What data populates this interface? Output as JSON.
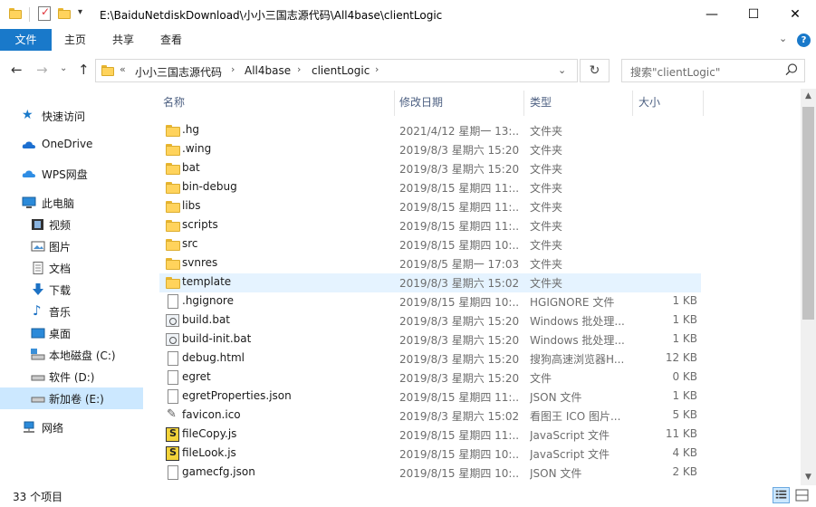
{
  "window": {
    "title": "E:\\BaiduNetdiskDownload\\小小三国志源代码\\All4base\\clientLogic",
    "minimize": "—",
    "maximize": "☐",
    "close": "✕"
  },
  "ribbon": {
    "tabs": [
      "文件",
      "主页",
      "共享",
      "查看"
    ],
    "expand": "⌄",
    "help": "?"
  },
  "nav": {
    "back": "←",
    "forward": "→",
    "recent": "⌄",
    "up": "↑",
    "overflow": "«",
    "breadcrumbs": [
      "小小三国志源代码",
      "All4base",
      "clientLogic"
    ],
    "crumb_sep": "›",
    "dropdown": "⌄",
    "refresh": "↻",
    "search_placeholder": "搜索\"clientLogic\""
  },
  "sidebar": {
    "items": [
      {
        "label": "快速访问",
        "icon": "star-icon"
      },
      {
        "label": "OneDrive",
        "icon": "cloud-icon"
      },
      {
        "label": "WPS网盘",
        "icon": "wps-cloud-icon"
      },
      {
        "label": "此电脑",
        "icon": "computer-icon"
      },
      {
        "label": "视频",
        "icon": "video-icon"
      },
      {
        "label": "图片",
        "icon": "pictures-icon"
      },
      {
        "label": "文档",
        "icon": "documents-icon"
      },
      {
        "label": "下载",
        "icon": "download-icon"
      },
      {
        "label": "音乐",
        "icon": "music-icon"
      },
      {
        "label": "桌面",
        "icon": "desktop-icon"
      },
      {
        "label": "本地磁盘 (C:)",
        "icon": "drive-c-icon"
      },
      {
        "label": "软件 (D:)",
        "icon": "drive-icon"
      },
      {
        "label": "新加卷 (E:)",
        "icon": "drive-icon",
        "selected": true
      },
      {
        "label": "网络",
        "icon": "network-icon"
      }
    ]
  },
  "list": {
    "sort_indicator": "^",
    "headers": {
      "name": "名称",
      "date": "修改日期",
      "type": "类型",
      "size": "大小"
    },
    "rows": [
      {
        "name": ".hg",
        "date": "2021/4/12 星期一 13:...",
        "type": "文件夹",
        "size": "",
        "icon": "folder-icon"
      },
      {
        "name": ".wing",
        "date": "2019/8/3 星期六 15:20",
        "type": "文件夹",
        "size": "",
        "icon": "folder-icon"
      },
      {
        "name": "bat",
        "date": "2019/8/3 星期六 15:20",
        "type": "文件夹",
        "size": "",
        "icon": "folder-icon"
      },
      {
        "name": "bin-debug",
        "date": "2019/8/15 星期四 11:...",
        "type": "文件夹",
        "size": "",
        "icon": "folder-icon"
      },
      {
        "name": "libs",
        "date": "2019/8/15 星期四 11:...",
        "type": "文件夹",
        "size": "",
        "icon": "folder-icon"
      },
      {
        "name": "scripts",
        "date": "2019/8/15 星期四 11:...",
        "type": "文件夹",
        "size": "",
        "icon": "folder-icon"
      },
      {
        "name": "src",
        "date": "2019/8/15 星期四 10:...",
        "type": "文件夹",
        "size": "",
        "icon": "folder-icon"
      },
      {
        "name": "svnres",
        "date": "2019/8/5 星期一 17:03",
        "type": "文件夹",
        "size": "",
        "icon": "folder-icon"
      },
      {
        "name": "template",
        "date": "2019/8/3 星期六 15:02",
        "type": "文件夹",
        "size": "",
        "icon": "folder-icon",
        "selected": true
      },
      {
        "name": ".hgignore",
        "date": "2019/8/15 星期四 10:...",
        "type": "HGIGNORE 文件",
        "size": "1 KB",
        "icon": "file-icon"
      },
      {
        "name": "build.bat",
        "date": "2019/8/3 星期六 15:20",
        "type": "Windows 批处理...",
        "size": "1 KB",
        "icon": "batch-icon"
      },
      {
        "name": "build-init.bat",
        "date": "2019/8/3 星期六 15:20",
        "type": "Windows 批处理...",
        "size": "1 KB",
        "icon": "batch-icon"
      },
      {
        "name": "debug.html",
        "date": "2019/8/3 星期六 15:20",
        "type": "搜狗高速浏览器H...",
        "size": "12 KB",
        "icon": "file-icon"
      },
      {
        "name": "egret",
        "date": "2019/8/3 星期六 15:20",
        "type": "文件",
        "size": "0 KB",
        "icon": "file-icon"
      },
      {
        "name": "egretProperties.json",
        "date": "2019/8/15 星期四 11:...",
        "type": "JSON 文件",
        "size": "1 KB",
        "icon": "file-icon"
      },
      {
        "name": "favicon.ico",
        "date": "2019/8/3 星期六 15:02",
        "type": "看图王 ICO 图片...",
        "size": "5 KB",
        "icon": "ico-icon"
      },
      {
        "name": "fileCopy.js",
        "date": "2019/8/15 星期四 11:...",
        "type": "JavaScript 文件",
        "size": "11 KB",
        "icon": "javascript-icon"
      },
      {
        "name": "fileLook.js",
        "date": "2019/8/15 星期四 10:...",
        "type": "JavaScript 文件",
        "size": "4 KB",
        "icon": "javascript-icon"
      },
      {
        "name": "gamecfg.json",
        "date": "2019/8/15 星期四 10:...",
        "type": "JSON 文件",
        "size": "2 KB",
        "icon": "file-icon"
      }
    ]
  },
  "status": {
    "count": "33 个项目"
  },
  "colors": {
    "accent": "#1979ca",
    "selection": "#cce8ff",
    "row_selection": "#e5f3ff",
    "folder": "#ffd35c"
  }
}
